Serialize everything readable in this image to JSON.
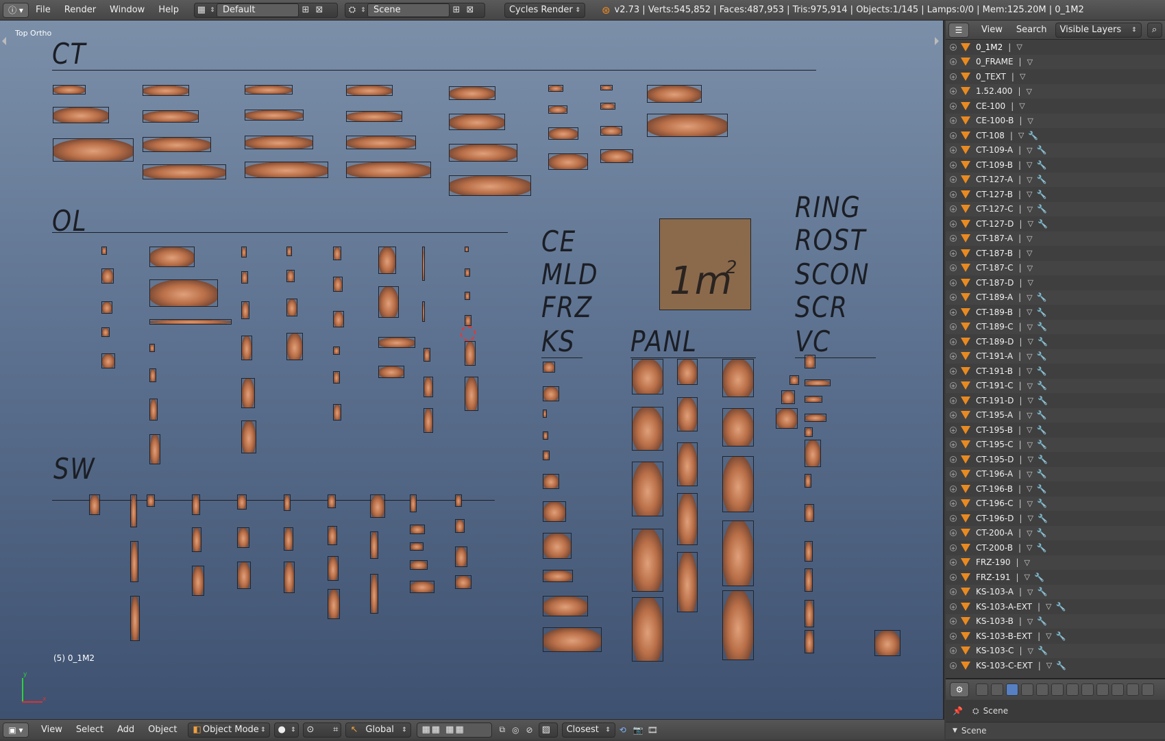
{
  "topbar": {
    "editor_icon": "info-icon",
    "menus": [
      "File",
      "Render",
      "Window",
      "Help"
    ],
    "layout": "Default",
    "scene": "Scene",
    "engine": "Cycles Render",
    "stats": "v2.73 | Verts:545,852 | Faces:487,953 | Tris:975,914 | Objects:1/145 | Lamps:0/0 | Mem:125.20M | 0_1M2"
  },
  "viewport": {
    "view_name": "Top Ortho",
    "active_object": "(5) 0_1M2",
    "axis_x": "x",
    "axis_y": "y",
    "sections": {
      "ct": "CT",
      "ol": "OL",
      "sw": "SW",
      "ce": "CE",
      "mld": "MLD",
      "frz": "FRZ",
      "ks": "KS",
      "panl": "PANL",
      "ring": "RING",
      "rost": "ROST",
      "scon": "SCON",
      "scr": "SCR",
      "vc": "VC"
    },
    "area_box_text": "1m",
    "area_box_sup": "2"
  },
  "vp_header": {
    "menus": [
      "View",
      "Select",
      "Add",
      "Object"
    ],
    "mode": "Object Mode",
    "orientation": "Global",
    "snap": "Closest"
  },
  "outliner": {
    "header": {
      "view": "View",
      "search": "Search",
      "filter": "Visible Layers"
    },
    "items": [
      {
        "name": "0_1M2",
        "wrench": false,
        "selected": true
      },
      {
        "name": "0_FRAME",
        "wrench": false
      },
      {
        "name": "0_TEXT",
        "wrench": false
      },
      {
        "name": "1.52.400",
        "wrench": false
      },
      {
        "name": "CE-100",
        "wrench": false
      },
      {
        "name": "CE-100-B",
        "wrench": false
      },
      {
        "name": "CT-108",
        "wrench": true
      },
      {
        "name": "CT-109-A",
        "wrench": true
      },
      {
        "name": "CT-109-B",
        "wrench": true
      },
      {
        "name": "CT-127-A",
        "wrench": true
      },
      {
        "name": "CT-127-B",
        "wrench": true
      },
      {
        "name": "CT-127-C",
        "wrench": true
      },
      {
        "name": "CT-127-D",
        "wrench": true
      },
      {
        "name": "CT-187-A",
        "wrench": false
      },
      {
        "name": "CT-187-B",
        "wrench": false
      },
      {
        "name": "CT-187-C",
        "wrench": false
      },
      {
        "name": "CT-187-D",
        "wrench": false
      },
      {
        "name": "CT-189-A",
        "wrench": true
      },
      {
        "name": "CT-189-B",
        "wrench": true
      },
      {
        "name": "CT-189-C",
        "wrench": true
      },
      {
        "name": "CT-189-D",
        "wrench": true
      },
      {
        "name": "CT-191-A",
        "wrench": true
      },
      {
        "name": "CT-191-B",
        "wrench": true
      },
      {
        "name": "CT-191-C",
        "wrench": true
      },
      {
        "name": "CT-191-D",
        "wrench": true
      },
      {
        "name": "CT-195-A",
        "wrench": true
      },
      {
        "name": "CT-195-B",
        "wrench": true
      },
      {
        "name": "CT-195-C",
        "wrench": true
      },
      {
        "name": "CT-195-D",
        "wrench": true
      },
      {
        "name": "CT-196-A",
        "wrench": true
      },
      {
        "name": "CT-196-B",
        "wrench": true
      },
      {
        "name": "CT-196-C",
        "wrench": true
      },
      {
        "name": "CT-196-D",
        "wrench": true
      },
      {
        "name": "CT-200-A",
        "wrench": true
      },
      {
        "name": "CT-200-B",
        "wrench": true
      },
      {
        "name": "FRZ-190",
        "wrench": false
      },
      {
        "name": "FRZ-191",
        "wrench": true
      },
      {
        "name": "KS-103-A",
        "wrench": true
      },
      {
        "name": "KS-103-A-EXT",
        "wrench": true
      },
      {
        "name": "KS-103-B",
        "wrench": true
      },
      {
        "name": "KS-103-B-EXT",
        "wrench": true
      },
      {
        "name": "KS-103-C",
        "wrench": true
      },
      {
        "name": "KS-103-C-EXT",
        "wrench": true
      }
    ]
  },
  "properties": {
    "scene_label": "Scene",
    "panel_label": "Scene"
  }
}
